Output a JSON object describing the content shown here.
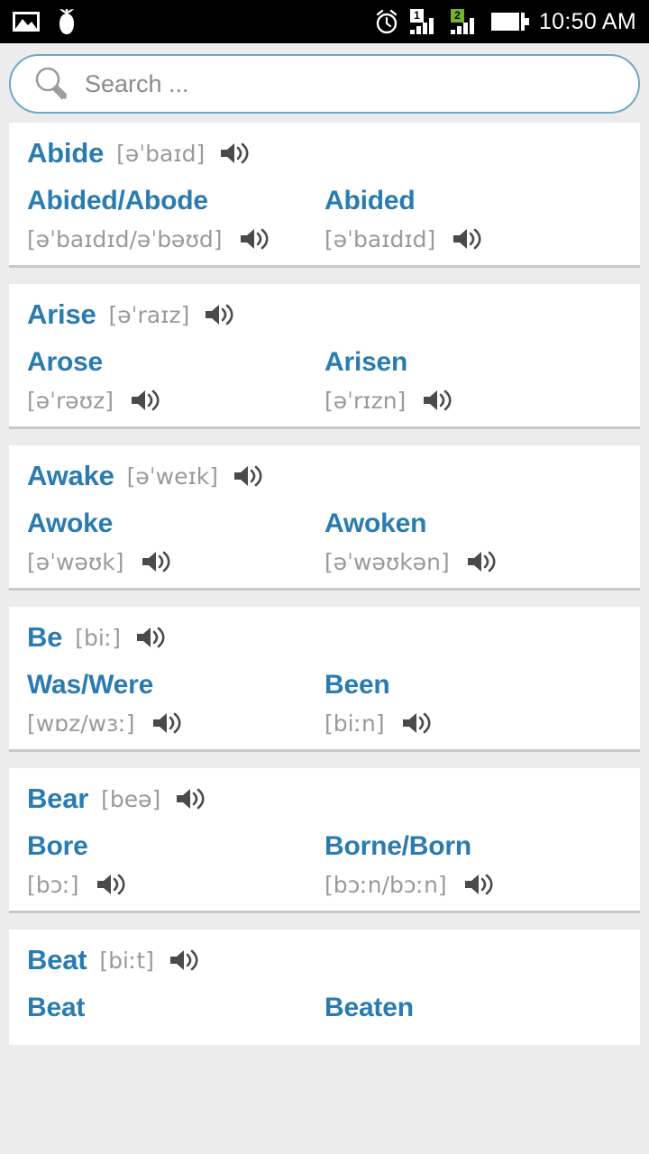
{
  "statusbar": {
    "icons_left": [
      "photo-icon",
      "pineapple-icon"
    ],
    "icons_right": [
      "alarm-icon",
      "signal-sim1-icon",
      "signal-sim2-icon",
      "battery-icon"
    ],
    "sim1_label": "1",
    "sim2_label": "2",
    "sim2_color": "#72b626",
    "time": "10:50 AM"
  },
  "search": {
    "placeholder": "Search ...",
    "value": "",
    "icon": "search-icon",
    "border_color": "#6fa8c8"
  },
  "theme": {
    "accent": "#2a7cb0",
    "ipa_gray": "#9a9a9a",
    "page_bg": "#ececec",
    "card_bg": "#ffffff"
  },
  "verbs": [
    {
      "infinitive": "Abide",
      "infinitive_ipa": "[əˈbaɪd]",
      "past": "Abided/Abode",
      "past_ipa": "[əˈbaɪdɪd/əˈbəʊd]",
      "participle": "Abided",
      "participle_ipa": "[əˈbaɪdɪd]"
    },
    {
      "infinitive": "Arise",
      "infinitive_ipa": "[əˈraɪz]",
      "past": "Arose",
      "past_ipa": "[əˈrəʊz]",
      "participle": "Arisen",
      "participle_ipa": "[əˈrɪzn]"
    },
    {
      "infinitive": "Awake",
      "infinitive_ipa": "[əˈweɪk]",
      "past": "Awoke",
      "past_ipa": "[əˈwəʊk]",
      "participle": "Awoken",
      "participle_ipa": "[əˈwəʊkən]"
    },
    {
      "infinitive": "Be",
      "infinitive_ipa": "[biː]",
      "past": "Was/Were",
      "past_ipa": "[wɒz/wɜː]",
      "participle": "Been",
      "participle_ipa": "[biːn]"
    },
    {
      "infinitive": "Bear",
      "infinitive_ipa": "[beə]",
      "past": "Bore",
      "past_ipa": "[bɔː]",
      "participle": "Borne/Born",
      "participle_ipa": "[bɔːn/bɔːn]"
    },
    {
      "infinitive": "Beat",
      "infinitive_ipa": "[biːt]",
      "past": "Beat",
      "past_ipa": "",
      "participle": "Beaten",
      "participle_ipa": ""
    }
  ]
}
